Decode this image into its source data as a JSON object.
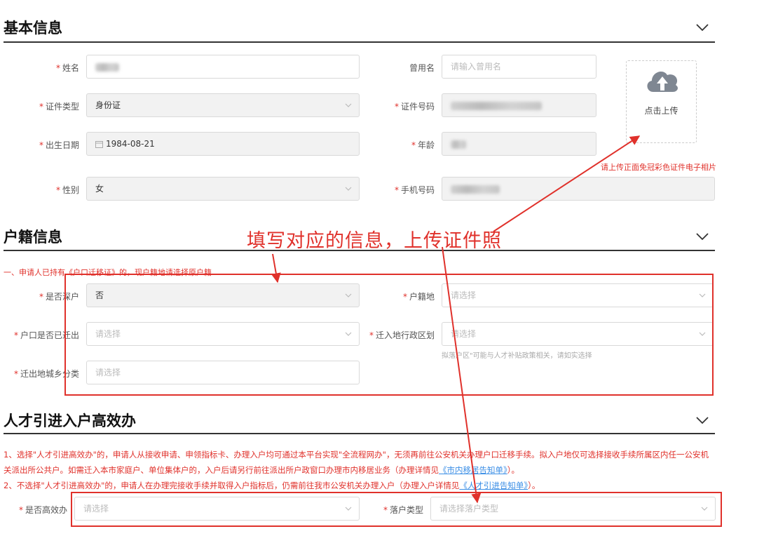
{
  "sections": {
    "basic": {
      "title": "基本信息"
    },
    "household": {
      "title": "户籍信息"
    },
    "talent": {
      "title": "人才引进入户高效办"
    }
  },
  "basic": {
    "name": {
      "label": "姓名",
      "required": "*"
    },
    "former_name": {
      "label": "曾用名",
      "placeholder": "请输入曾用名"
    },
    "id_type": {
      "label": "证件类型",
      "required": "*",
      "value": "身份证"
    },
    "id_number": {
      "label": "证件号码",
      "required": "*"
    },
    "birth_date": {
      "label": "出生日期",
      "required": "*",
      "value": "1984-08-21"
    },
    "age": {
      "label": "年龄",
      "required": "*"
    },
    "gender": {
      "label": "性别",
      "required": "*",
      "value": "女"
    },
    "phone": {
      "label": "手机号码",
      "required": "*"
    },
    "upload": {
      "label": "点击上传",
      "hint": "请上传正面免冠彩色证件电子相片"
    }
  },
  "household": {
    "note": "一、申请人已持有《户口迁移证》的，现户籍地请选择原户籍",
    "is_shenzhen": {
      "label": "是否深户",
      "required": "*",
      "value": "否"
    },
    "hukou_location": {
      "label": "户籍地",
      "required": "*",
      "placeholder": "请选择"
    },
    "moved_out": {
      "label": "户口是否已迁出",
      "required": "*",
      "placeholder": "请选择"
    },
    "move_in_district": {
      "label": "迁入地行政区划",
      "required": "*",
      "placeholder": "请选择",
      "hint": "拟落户区\"可能与人才补贴政策相关，请如实选择"
    },
    "origin_type": {
      "label": "迁出地城乡分类",
      "required": "*",
      "placeholder": "请选择"
    }
  },
  "talent": {
    "p1_a": "1、选择\"人才引进高效办\"的，申请人从接收申请、申领指标卡、办理入户均可通过本平台实现\"全流程网办\"，无须再前往公安机关办理户口迁移手续。拟入户地仅可选择接收手续所属区内任一公安机关派出所公共户。如需迁入本市家庭户、单位集体户的，入户后请另行前往派出所户政窗口办理市内移居业务（办理详情见",
    "p1_link": "《市内移居告知单》",
    "p1_b": "）。",
    "p2_a": "2、不选择\"人才引进高效办\"的，申请人在办理完接收手续并取得入户指标后，仍需前往我市公安机关办理入户（办理入户详情见",
    "p2_link": "《人才引进告知单》",
    "p2_b": "）。",
    "efficient": {
      "label": "是否高效办",
      "required": "*",
      "placeholder": "请选择"
    },
    "settle_type": {
      "label": "落户类型",
      "required": "*",
      "placeholder": "请选择落户类型"
    }
  },
  "annotation": {
    "text": "填写对应的信息，上传证件照"
  },
  "colors": {
    "annotation_red": "#e0312b",
    "link_blue": "#3a8ee6",
    "disabled_bg": "#f2f2f2"
  }
}
